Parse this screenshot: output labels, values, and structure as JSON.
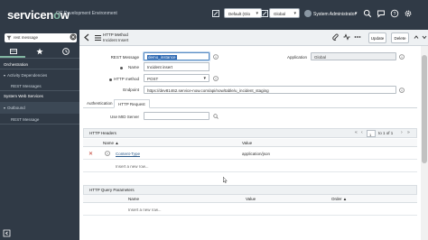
{
  "banner": {
    "logo": "servicenow",
    "instance": "OC Development Environment",
    "scope_select": "Default (Glo",
    "app_select": "Global",
    "user": "System Administrator"
  },
  "nav": {
    "filter_value": "rest message",
    "sections": [
      {
        "label": "Orchestration",
        "type": "head"
      },
      {
        "label": "Activity Dependencies",
        "type": "group"
      },
      {
        "label": "REST Messages",
        "type": "item"
      },
      {
        "label": "System Web Services",
        "type": "head"
      },
      {
        "label": "Outbound",
        "type": "group"
      },
      {
        "label": "REST Message",
        "type": "item"
      }
    ]
  },
  "form_header": {
    "title": "HTTP Method",
    "subtitle": "Incident Insert",
    "update_label": "Update",
    "delete_label": "Delete"
  },
  "form": {
    "rest_message_label": "REST Message",
    "rest_message_value": "demo_instance",
    "dropdown_option": "Incident insert",
    "name_label": "Name",
    "http_method_label": "HTTP method",
    "http_method_value": "POST",
    "endpoint_label": "Endpoint",
    "endpoint_value": "https://dev81462.service-now.com/api/now/table/u_incident_staging",
    "application_label": "Application",
    "application_value": "Global"
  },
  "tabs": [
    {
      "label": "Authentication",
      "active": false
    },
    {
      "label": "HTTP Request",
      "active": true
    }
  ],
  "mid_server": {
    "label": "Use MID Server"
  },
  "http_headers": {
    "title": "HTTP Headers",
    "columns": [
      "Name ▲",
      "Value"
    ],
    "rows": [
      {
        "name": "Content-Type",
        "value": "application/json"
      }
    ],
    "insert_text": "Insert a new row...",
    "page": "1",
    "page_text": "to 1 of 1"
  },
  "query_params": {
    "title": "HTTP Query Parameters",
    "columns": [
      "Name",
      "Value",
      "Order ▲"
    ],
    "insert_text": "Insert a new row..."
  }
}
